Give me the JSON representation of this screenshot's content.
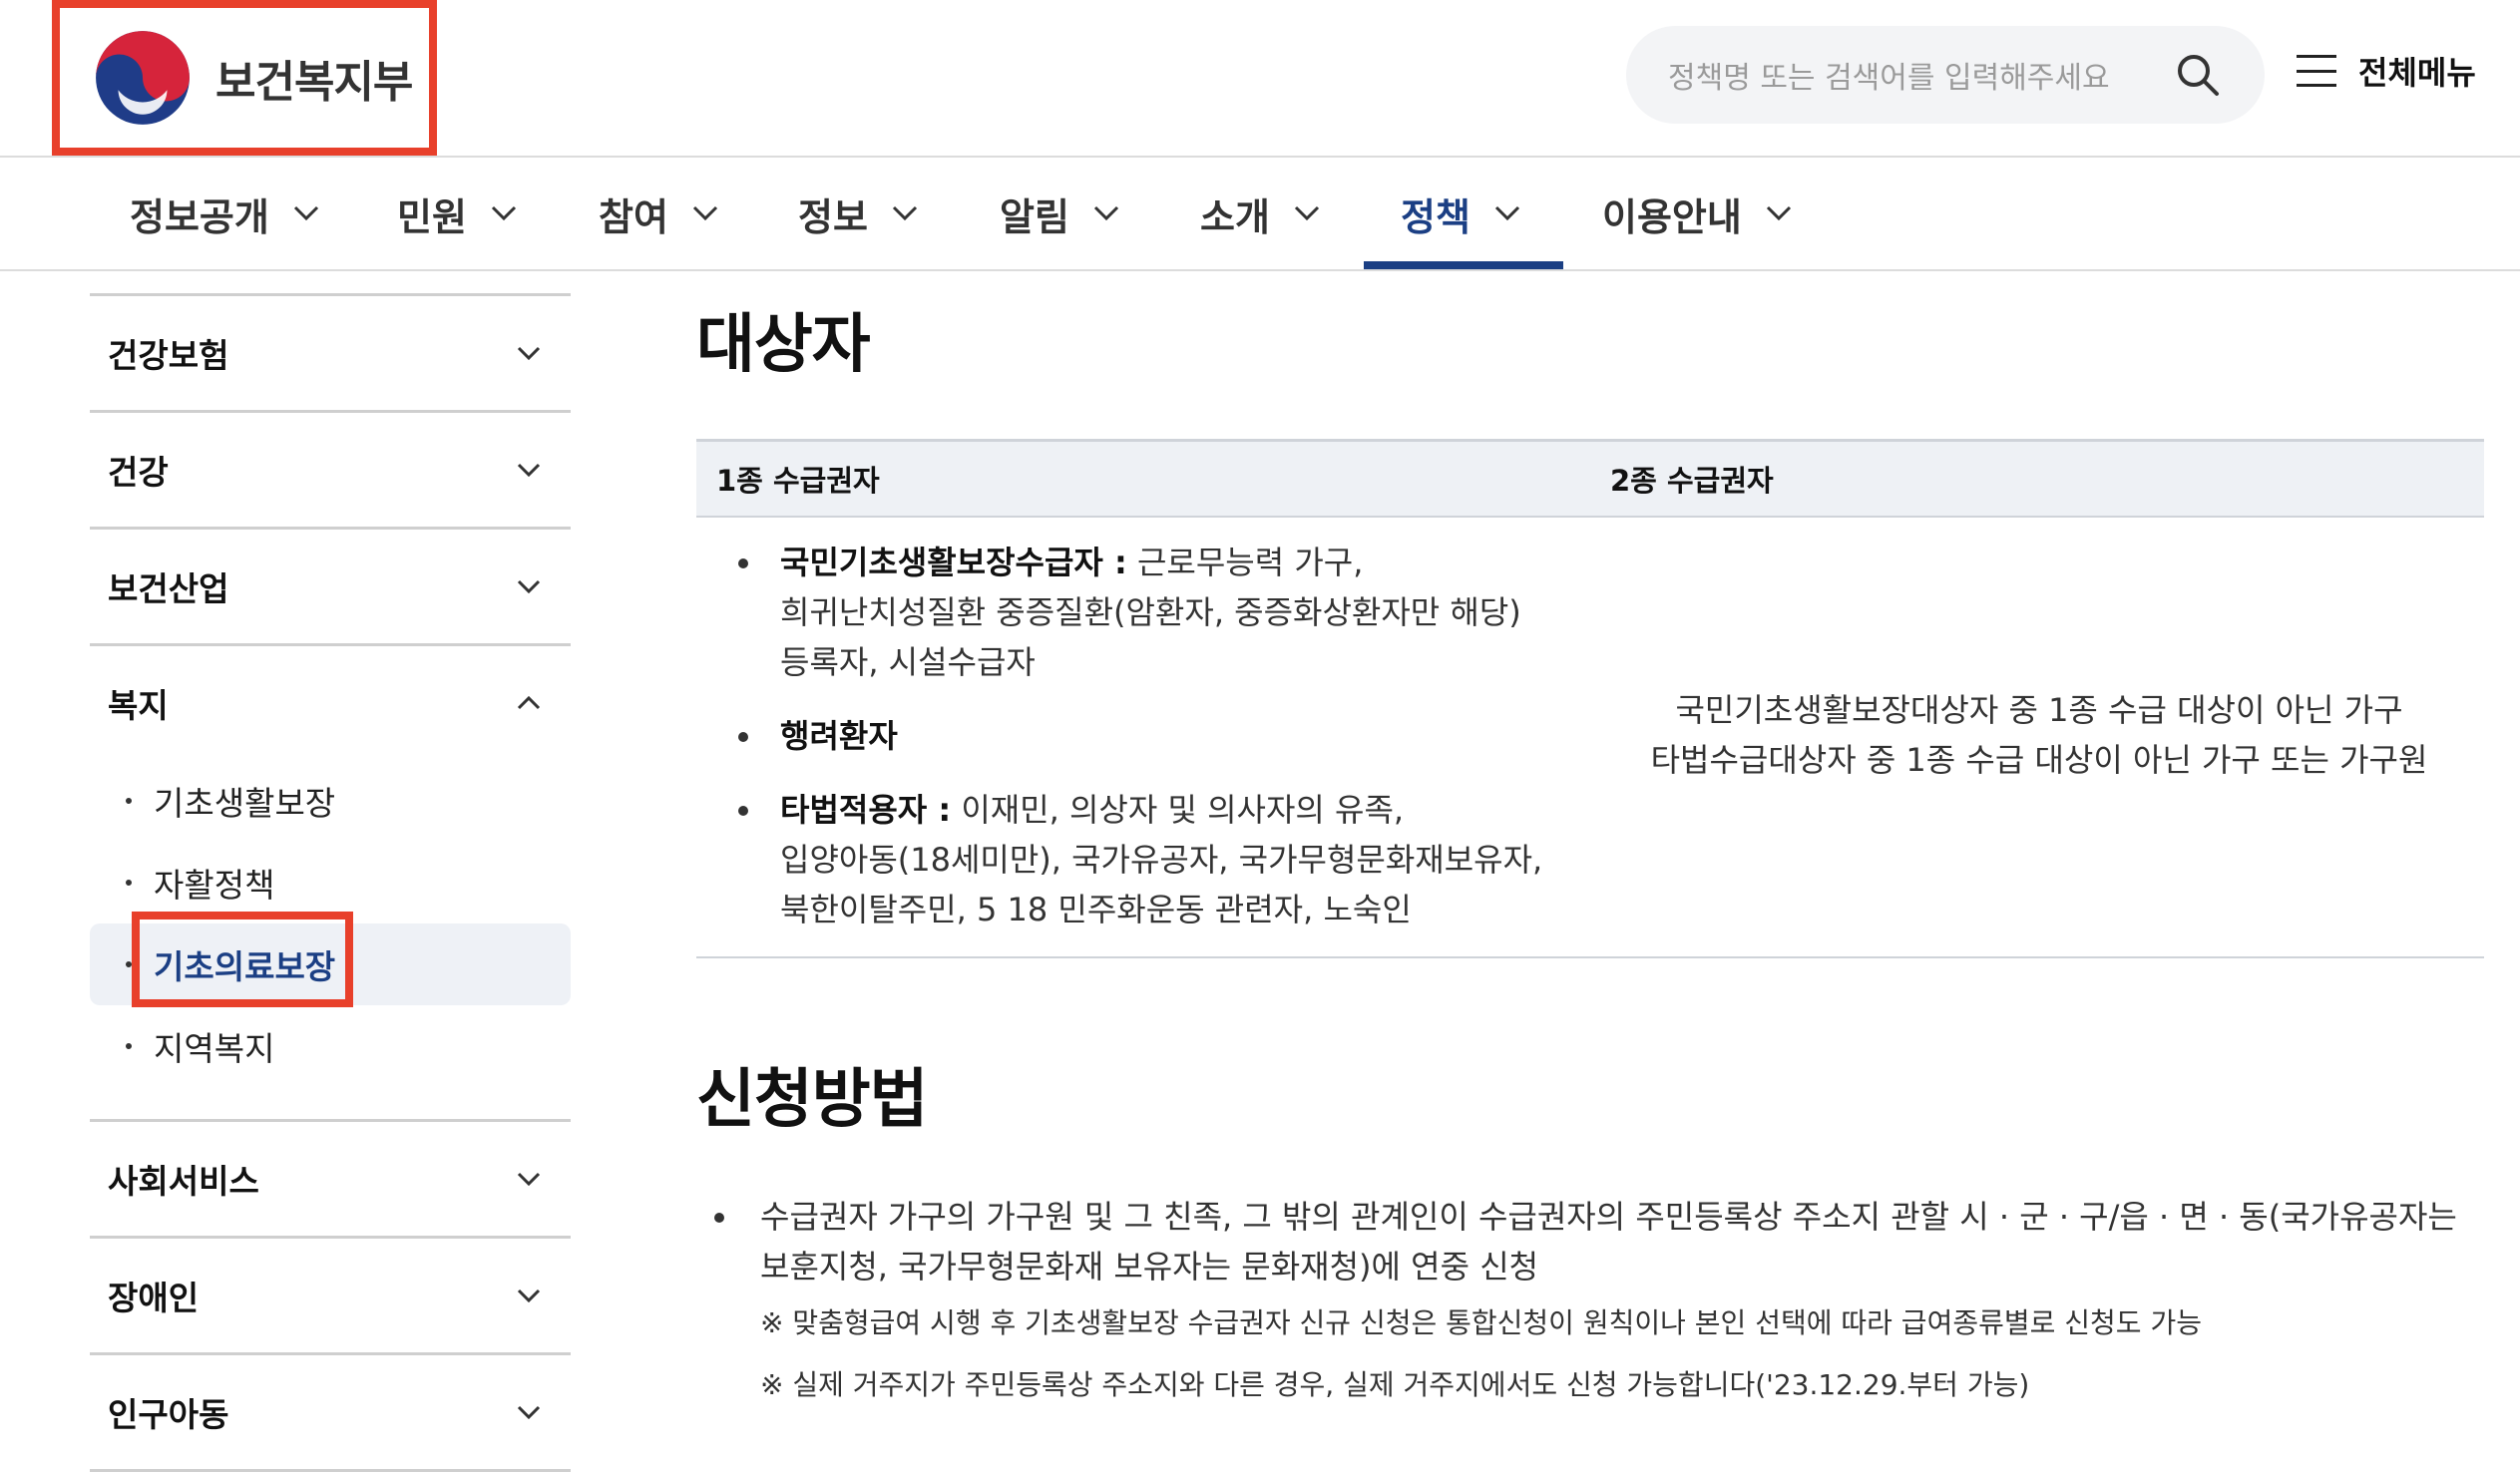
{
  "header": {
    "logo_text": "보건복지부",
    "search_placeholder": "정책명 또는 검색어를 입력해주세요",
    "allmenu_label": "전체메뉴",
    "highlight_color": "#e8402b"
  },
  "gnb": {
    "items": [
      "정보공개",
      "민원",
      "참여",
      "정보",
      "알림",
      "소개",
      "정책",
      "이용안내"
    ],
    "active": "정책",
    "active_color": "#1b3f84"
  },
  "lnb": {
    "items_before": [
      "건강보험",
      "건강",
      "보건산업"
    ],
    "open_item": "복지",
    "sub_items": [
      "기초생활보장",
      "자활정책",
      "기초의료보장",
      "지역복지"
    ],
    "active_sub": "기초의료보장",
    "items_after": [
      "사회서비스",
      "장애인",
      "인구아동"
    ]
  },
  "content": {
    "section1_title": "대상자",
    "table": {
      "headers": [
        "1종 수급권자",
        "2종 수급권자"
      ],
      "col1": [
        {
          "bold": "국민기초생활보장수급자 :",
          "text": " 근로무능력 가구,",
          "lines": [
            "희귀난치성질환 중증질환(암환자, 중증화상환자만 해당)",
            "등록자, 시설수급자"
          ]
        },
        {
          "bold": "행려환자",
          "text": "",
          "lines": []
        },
        {
          "bold": "타법적용자 :",
          "text": " 이재민, 의상자 및 의사자의 유족,",
          "lines": [
            "입양아동(18세미만), 국가유공자, 국가무형문화재보유자,",
            "북한이탈주민, 5 18 민주화운동 관련자, 노숙인"
          ]
        }
      ],
      "col2": [
        "국민기초생활보장대상자 중 1종 수급 대상이 아닌 가구",
        "타법수급대상자 중 1종 수급 대상이 아닌 가구 또는 가구원"
      ]
    },
    "section2_title": "신청방법",
    "apply_text_line1": "수급권자 가구의 가구원 및 그 친족, 그 밖의 관계인이 수급권자의 주민등록상 주소지 관할 시 · 군 · 구/읍 · 면 · 동(국가유공자는",
    "apply_text_line2": "보훈지청, 국가무형문화재 보유자는 문화재청)에 연중 신청",
    "note1": "※ 맞춤형급여 시행 후 기초생활보장 수급권자 신규 신청은 통합신청이 원칙이나 본인 선택에 따라 급여종류별로 신청도 가능",
    "note2": "※ 실제 거주지가 주민등록상 주소지와 다른 경우, 실제 거주지에서도 신청 가능합니다('23.12.29.부터 가능)"
  }
}
